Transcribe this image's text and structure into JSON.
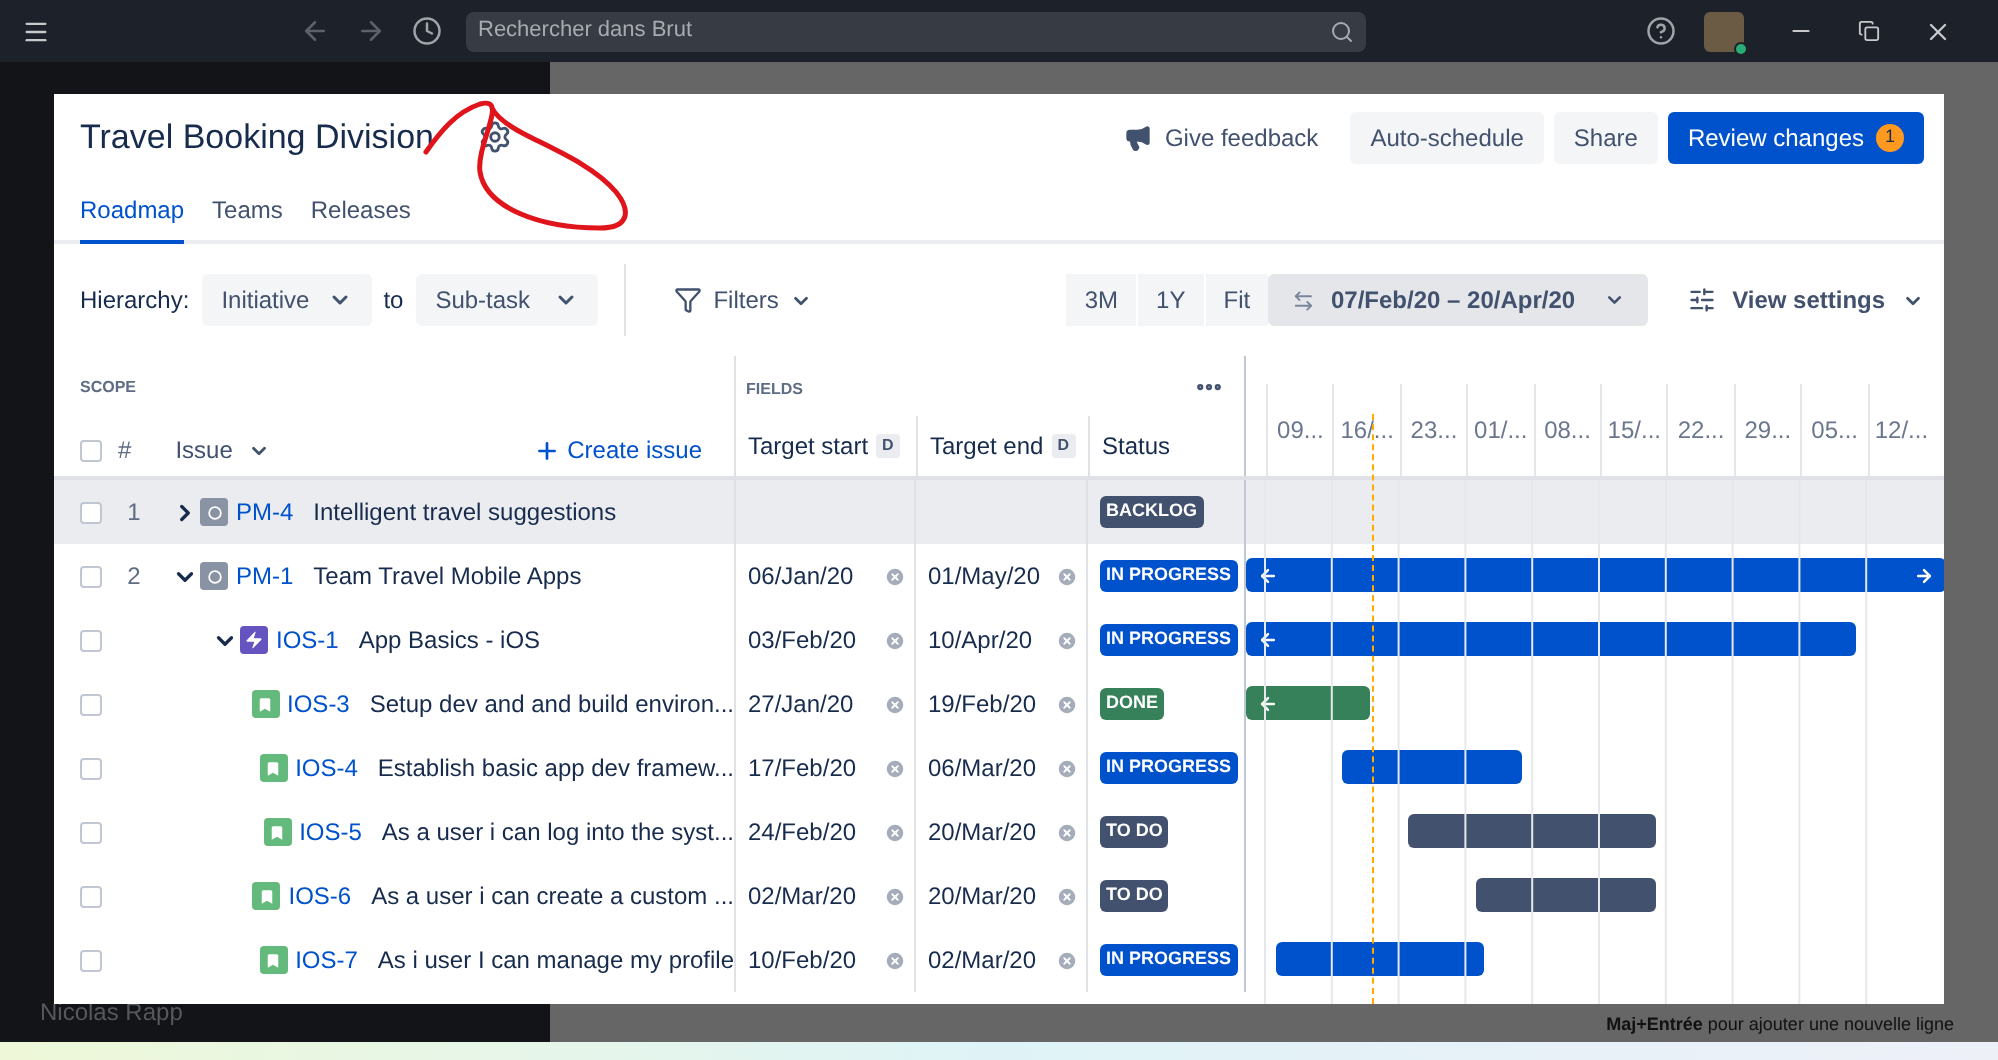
{
  "topbar": {
    "search": {
      "placeholder": "Rechercher dans Brut"
    }
  },
  "modal": {
    "title": "Travel Booking Division",
    "header_buttons": [
      {
        "label": "Give feedback",
        "kind": "feedback"
      },
      {
        "label": "Auto-schedule",
        "kind": "secondary"
      },
      {
        "label": "Share",
        "kind": "secondary"
      },
      {
        "label": "Review changes",
        "kind": "primary",
        "badge": "1"
      }
    ],
    "tabs": [
      {
        "label": "Roadmap",
        "selected": true
      },
      {
        "label": "Teams",
        "selected": false
      },
      {
        "label": "Releases",
        "selected": false
      }
    ],
    "toolbar": {
      "hierarchy_label": "Hierarchy:",
      "from": "Initiative",
      "to_label": "to",
      "to": "Sub-task",
      "filters": "Filters",
      "zoom": [
        {
          "label": "3M",
          "selected": false
        },
        {
          "label": "1Y",
          "selected": false
        },
        {
          "label": "Fit",
          "selected": false
        }
      ],
      "date_range": "07/Feb/20 – 20/Apr/20",
      "view_settings": "View settings"
    },
    "table": {
      "scope_label": "SCOPE",
      "fields_label": "FIELDS",
      "select_all": {
        "checked": false
      },
      "number_header": "#",
      "issue_header": "Issue",
      "create_issue": "Create issue",
      "columns": [
        {
          "label": "Target start",
          "badge": "D"
        },
        {
          "label": "Target end",
          "badge": "D"
        },
        {
          "label": "Status"
        }
      ],
      "timeline_labels": [
        "09...",
        "16/...",
        "23...",
        "01/...",
        "08...",
        "15/...",
        "22...",
        "29...",
        "05...",
        "12/..."
      ],
      "rows": [
        {
          "number": "1",
          "kind": "initiative",
          "key": "PM-4",
          "summary": "Intelligent travel suggestions",
          "status": "BACKLOG",
          "color": "#42526e",
          "checked": false,
          "selected": true,
          "expanded": false
        },
        {
          "number": "2",
          "kind": "initiative",
          "key": "PM-1",
          "summary": "Team Travel Mobile Apps",
          "start": "06/Jan/20",
          "end": "01/May/20",
          "status": "IN PROGRESS",
          "color": "#0052cc",
          "checked": false,
          "selected": false,
          "expanded": true,
          "overflow_left": true,
          "overflow_right": true,
          "children": [
            {
              "kind": "epic",
              "key": "IOS-1",
              "summary": "App Basics - iOS",
              "start": "03/Feb/20",
              "end": "10/Apr/20",
              "status": "IN PROGRESS",
              "color": "#0052cc",
              "checked": false,
              "selected": false,
              "expanded": true,
              "overflow_left": true,
              "overflow_right": false,
              "children": [
                {
                  "kind": "story",
                  "key": "IOS-3",
                  "summary": "Setup dev and and build environ...",
                  "start": "27/Jan/20",
                  "end": "19/Feb/20",
                  "status": "DONE",
                  "color": "#36805a",
                  "checked": false,
                  "selected": false,
                  "overflow_left": true,
                  "overflow_right": false
                },
                {
                  "kind": "story",
                  "key": "IOS-4",
                  "summary": "Establish basic app dev framew...",
                  "start": "17/Feb/20",
                  "end": "06/Mar/20",
                  "status": "IN PROGRESS",
                  "color": "#0052cc",
                  "checked": false,
                  "selected": false,
                  "overflow_left": false,
                  "overflow_right": false
                },
                {
                  "kind": "story",
                  "key": "IOS-5",
                  "summary": "As a user i can log into the syst...",
                  "start": "24/Feb/20",
                  "end": "20/Mar/20",
                  "status": "TO DO",
                  "color": "#42526e",
                  "checked": false,
                  "selected": false,
                  "overflow_left": false,
                  "overflow_right": false
                },
                {
                  "kind": "story",
                  "key": "IOS-6",
                  "summary": "As a user i can create a custom ...",
                  "start": "02/Mar/20",
                  "end": "20/Mar/20",
                  "status": "TO DO",
                  "color": "#42526e",
                  "checked": false,
                  "selected": false,
                  "overflow_left": false,
                  "overflow_right": false
                },
                {
                  "kind": "story",
                  "key": "IOS-7",
                  "summary": "As i user I can manage my profile",
                  "start": "10/Feb/20",
                  "end": "02/Mar/20",
                  "status": "IN PROGRESS",
                  "color": "#0052cc",
                  "checked": false,
                  "selected": false,
                  "overflow_left": false,
                  "overflow_right": false
                }
              ]
            }
          ]
        }
      ]
    }
  },
  "sidebar": {
    "user": "Nicolas Rapp"
  },
  "composer": {
    "hint": "**Maj+Entrée** pour ajouter une nouvelle ligne"
  }
}
